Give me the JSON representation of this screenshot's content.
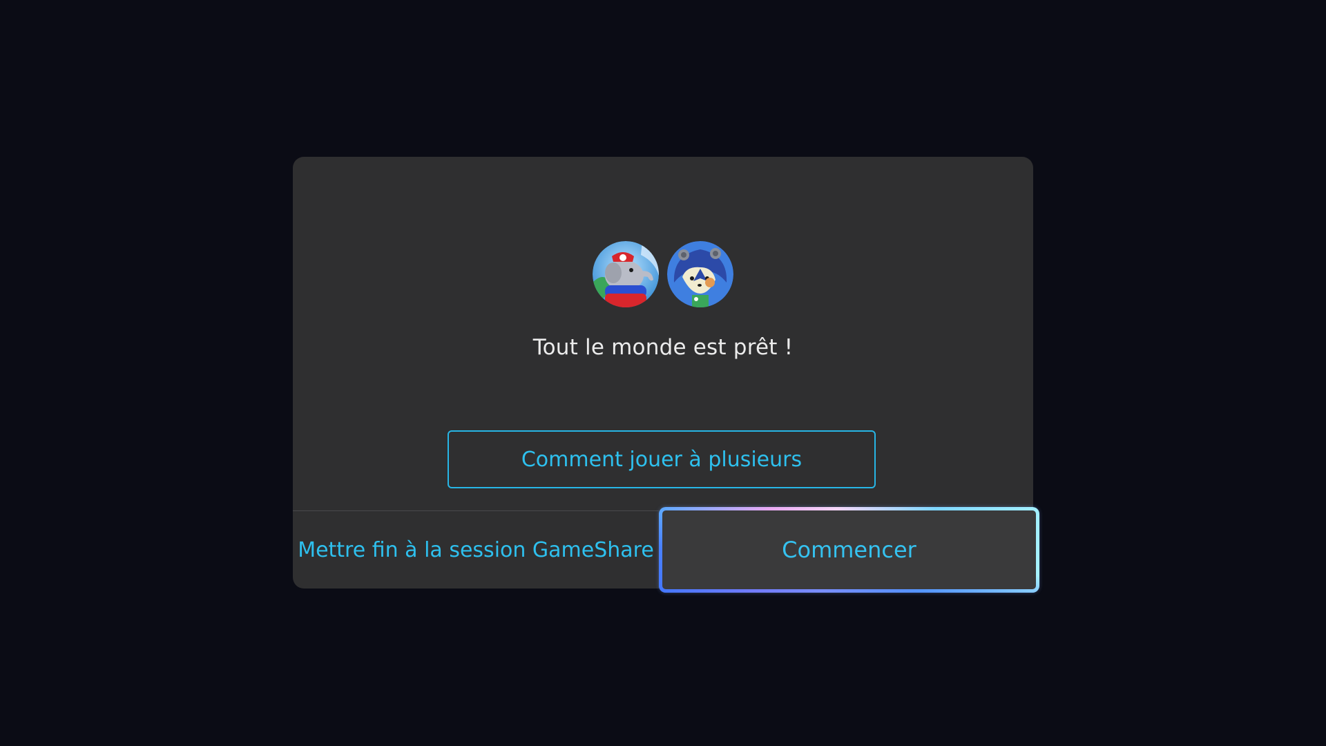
{
  "dialog": {
    "avatars": [
      {
        "name": "player-1-avatar",
        "icon": "elephant-mario-icon"
      },
      {
        "name": "player-2-avatar",
        "icon": "hedgehog-villager-icon"
      }
    ],
    "status_text": "Tout le monde est prêt !",
    "how_to_play_label": "Comment jouer à plusieurs",
    "end_session_label": "Mettre fin à la session GameShare",
    "start_label": "Commencer"
  },
  "colors": {
    "background": "#0b0c15",
    "dialog": "#2f2f30",
    "accent": "#2ec0ee",
    "text": "#ececec"
  }
}
